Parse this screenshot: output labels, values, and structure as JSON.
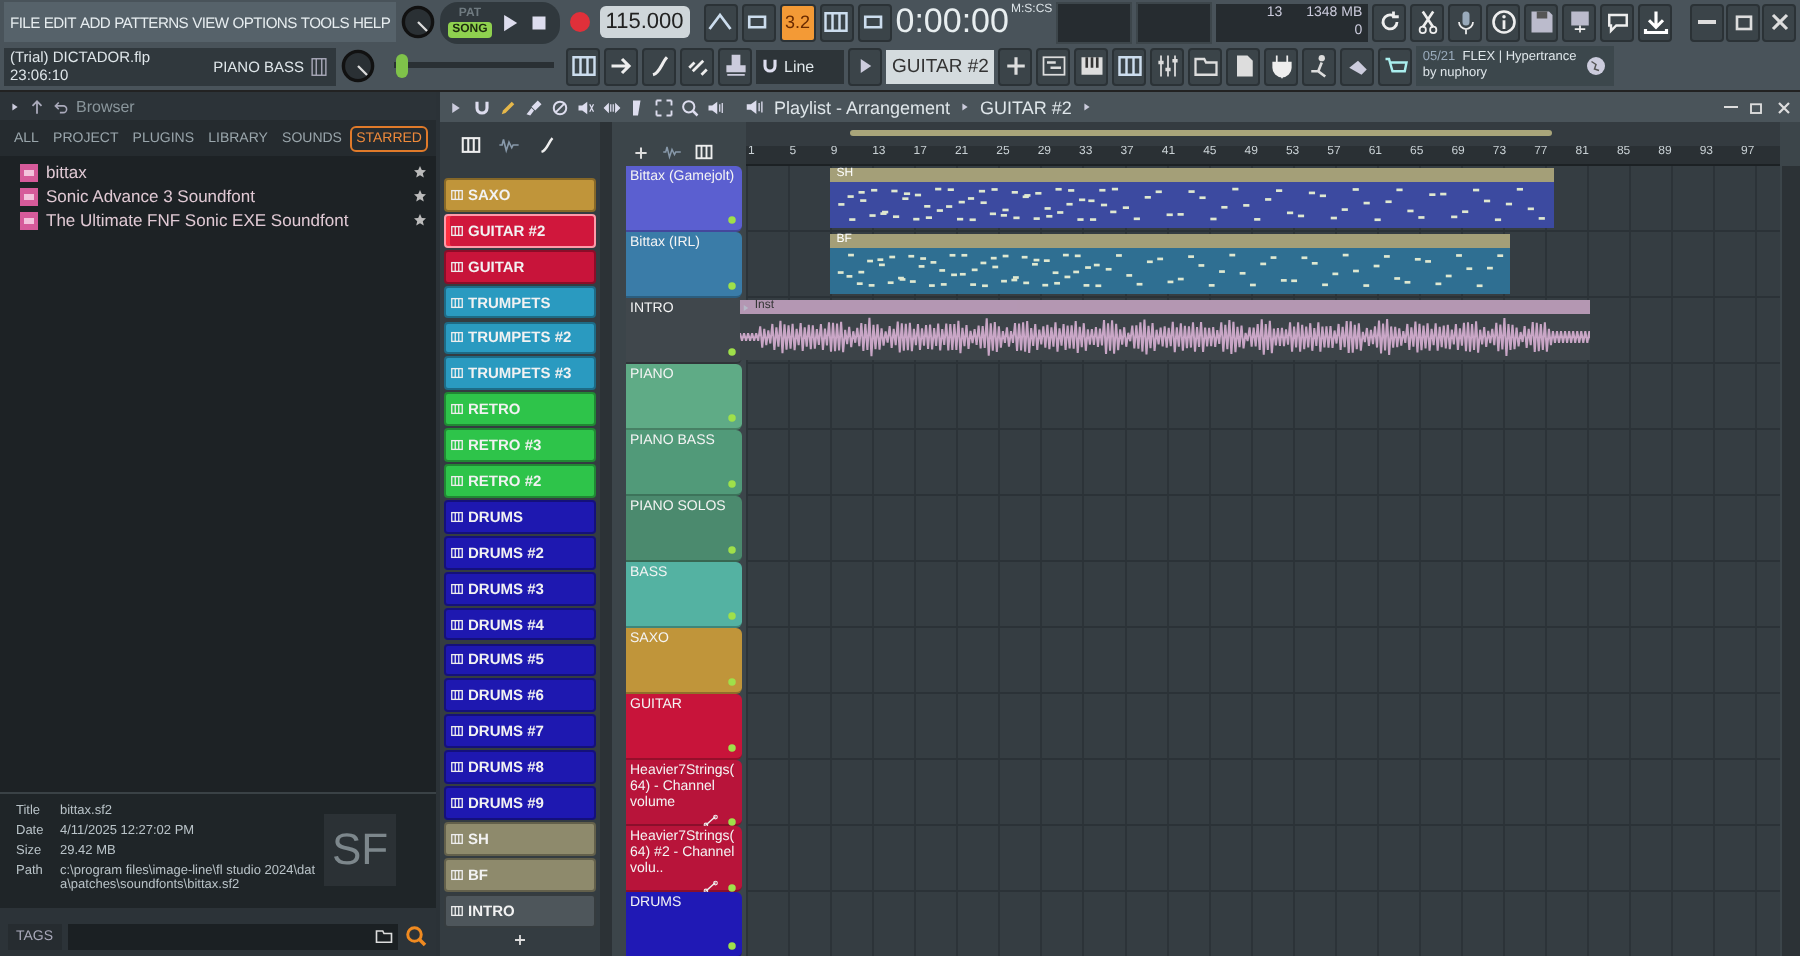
{
  "menu": [
    "FILE",
    "EDIT",
    "ADD",
    "PATTERNS",
    "VIEW",
    "OPTIONS",
    "TOOLS",
    "HELP"
  ],
  "project": {
    "file": "(Trial) DICTADOR.flp",
    "time": "23:06:10",
    "channel": "PIANO BASS"
  },
  "transport": {
    "modes": [
      {
        "label": "PAT",
        "selected": false
      },
      {
        "label": "SONG",
        "selected": true
      }
    ],
    "tempo": "115.000"
  },
  "typing_keyboard": {
    "label": "3.2",
    "on": true
  },
  "clock": {
    "value": "0:00:00",
    "unit": "M:S:CS"
  },
  "monitor": {
    "voices": "13",
    "memory": "1348 MB",
    "cpu": "0"
  },
  "master_pitch": {
    "level": 0.02
  },
  "snap": "Line",
  "pattern_selector": "GUITAR #2",
  "news": {
    "date": "05/21",
    "title": "FLEX | Hypertrance",
    "author": "by nuphory"
  },
  "browser": {
    "title": "Browser",
    "tabs": [
      {
        "label": "ALL",
        "selected": false
      },
      {
        "label": "PROJECT",
        "selected": false
      },
      {
        "label": "PLUGINS",
        "selected": false
      },
      {
        "label": "LIBRARY",
        "selected": false
      },
      {
        "label": "SOUNDS",
        "selected": false
      },
      {
        "label": "STARRED",
        "selected": true
      }
    ],
    "items": [
      {
        "name": "bittax"
      },
      {
        "name": "Sonic Advance 3 Soundfont"
      },
      {
        "name": "The Ultimate FNF Sonic EXE Soundfont"
      }
    ],
    "info": [
      {
        "label": "Title",
        "value": "bittax.sf2"
      },
      {
        "label": "Date",
        "value": "4/11/2025 12:27:02 PM"
      },
      {
        "label": "Size",
        "value": "29.42 MB"
      },
      {
        "label": "Path",
        "value": "c:\\program files\\image-line\\fl studio 2024\\data\\patches\\soundfonts\\bittax.sf2"
      }
    ],
    "file_badge": "SF",
    "tags_label": "TAGS"
  },
  "playlist": {
    "title": "Playlist - Arrangement",
    "pattern": "GUITAR #2",
    "patterns": [
      {
        "name": "SAXO",
        "color": "#c0953a",
        "selected": false
      },
      {
        "name": "GUITAR #2",
        "color": "#d0173c",
        "selected": true
      },
      {
        "name": "GUITAR",
        "color": "#c8143a",
        "selected": false
      },
      {
        "name": "TRUMPETS",
        "color": "#2a9ac0",
        "selected": false
      },
      {
        "name": "TRUMPETS #2",
        "color": "#2a9ac0",
        "selected": false
      },
      {
        "name": "TRUMPETS #3",
        "color": "#2a9ac0",
        "selected": false
      },
      {
        "name": "RETRO",
        "color": "#2ec44a",
        "selected": false
      },
      {
        "name": "RETRO #3",
        "color": "#2ec44a",
        "selected": false
      },
      {
        "name": "RETRO #2",
        "color": "#2ec44a",
        "selected": false
      },
      {
        "name": "DRUMS",
        "color": "#1e18b0",
        "selected": false
      },
      {
        "name": "DRUMS #2",
        "color": "#1e18b0",
        "selected": false
      },
      {
        "name": "DRUMS #3",
        "color": "#1e18b0",
        "selected": false
      },
      {
        "name": "DRUMS #4",
        "color": "#1e18b0",
        "selected": false
      },
      {
        "name": "DRUMS #5",
        "color": "#1e18b0",
        "selected": false
      },
      {
        "name": "DRUMS #6",
        "color": "#1e18b0",
        "selected": false
      },
      {
        "name": "DRUMS #7",
        "color": "#1e18b0",
        "selected": false
      },
      {
        "name": "DRUMS #8",
        "color": "#1e18b0",
        "selected": false
      },
      {
        "name": "DRUMS #9",
        "color": "#1e18b0",
        "selected": false
      },
      {
        "name": "SH",
        "color": "#8e8a6c",
        "selected": false
      },
      {
        "name": "BF",
        "color": "#8e8a6c",
        "selected": false
      },
      {
        "name": "INTRO",
        "color": "#4e565b",
        "selected": false
      }
    ],
    "ruler": [
      "1",
      "5",
      "9",
      "13",
      "17",
      "21",
      "25",
      "29",
      "33",
      "37",
      "41",
      "45",
      "49",
      "53",
      "57",
      "61",
      "65",
      "69",
      "73",
      "77",
      "81",
      "85",
      "89",
      "93",
      "97"
    ],
    "tracks": [
      {
        "name": "Bittax (Gamejolt)",
        "color": "#5b5fd0",
        "kind": "normal",
        "clip": {
          "kind": "pattern",
          "name": "SH",
          "color": "#3c4aa0"
        }
      },
      {
        "name": "Bittax (IRL)",
        "color": "#3a7ca8",
        "kind": "normal",
        "clip": {
          "kind": "pattern",
          "name": "BF",
          "color": "#2f6f92"
        }
      },
      {
        "name": "INTRO",
        "color": "#40474c",
        "kind": "normal",
        "clip": {
          "kind": "audio",
          "name": "Inst",
          "color": "#c9a6c6"
        }
      },
      {
        "name": "PIANO",
        "color": "#5fab86",
        "kind": "normal"
      },
      {
        "name": "PIANO BASS",
        "color": "#519a79",
        "kind": "normal"
      },
      {
        "name": "PIANO SOLOS",
        "color": "#4b8a6e",
        "kind": "normal"
      },
      {
        "name": "BASS",
        "color": "#54b2a2",
        "kind": "normal"
      },
      {
        "name": "SAXO",
        "color": "#c0953a",
        "kind": "normal"
      },
      {
        "name": "GUITAR",
        "color": "#c8143a",
        "kind": "normal"
      },
      {
        "name": "Heavier7Strings(64) - Channel volume",
        "color": "#b8143a",
        "kind": "automation"
      },
      {
        "name": "Heavier7Strings(64) #2 - Channel volu..",
        "color": "#b8143a",
        "kind": "automation"
      },
      {
        "name": "DRUMS",
        "color": "#2019b5",
        "kind": "normal"
      }
    ]
  }
}
